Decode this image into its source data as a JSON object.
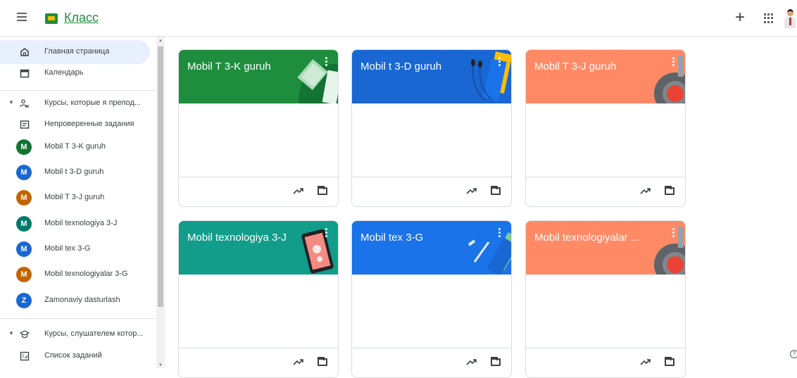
{
  "app": {
    "title": "Класс"
  },
  "header": {
    "add_icon": "plus-icon",
    "apps_icon": "grid-icon"
  },
  "sidebar": {
    "items": [
      {
        "label": "Главная страница",
        "icon": "home-icon",
        "active": true
      },
      {
        "label": "Календарь",
        "icon": "calendar-icon"
      }
    ],
    "teaching": {
      "label": "Курсы, которые я препод...",
      "todo_label": "Непроверенные задания",
      "courses": [
        {
          "initial": "M",
          "label": "Mobil T 3-K guruh",
          "color": "#137333"
        },
        {
          "initial": "M",
          "label": "Mobil t 3-D guruh",
          "color": "#1967d2"
        },
        {
          "initial": "M",
          "label": "Mobil T 3-J guruh",
          "color": "#c26401"
        },
        {
          "initial": "M",
          "label": "Mobil texnologiya 3-J",
          "color": "#00796b"
        },
        {
          "initial": "M",
          "label": "Mobil tex 3-G",
          "color": "#1967d2"
        },
        {
          "initial": "M",
          "label": "Mobil texnologiyalar 3-G",
          "color": "#c26401"
        },
        {
          "initial": "Z",
          "label": "Zamonaviy dasturlash",
          "color": "#1967d2"
        }
      ]
    },
    "enrolled": {
      "label": "Курсы, слушателем котор...",
      "todo_label": "Список заданий"
    }
  },
  "cards": [
    {
      "title": "Mobil T 3-K guruh",
      "color": "#1e8e3e",
      "theme": "notebook"
    },
    {
      "title": "Mobil t 3-D guruh",
      "color": "#1967d2",
      "theme": "headphones"
    },
    {
      "title": "Mobil T 3-J guruh",
      "color": "#ff8a65",
      "theme": "lab"
    },
    {
      "title": "Mobil texnologiya 3-J",
      "color": "#129c8a",
      "theme": "tablet"
    },
    {
      "title": "Mobil tex 3-G",
      "color": "#1a73e8",
      "theme": "pencil"
    },
    {
      "title": "Mobil texnologiyalar ...",
      "color": "#ff8a65",
      "theme": "lab"
    }
  ],
  "icons": {
    "trend": "trending-up-icon",
    "folder": "folder-icon",
    "help": "help-icon"
  }
}
